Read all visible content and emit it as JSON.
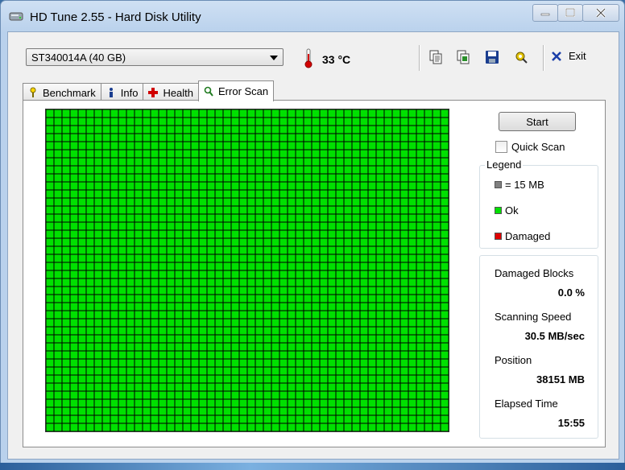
{
  "window": {
    "title": "HD Tune 2.55 - Hard Disk Utility"
  },
  "toolbar": {
    "drive": "ST340014A (40 GB)",
    "temperature": "33 °C",
    "exit_label": "Exit"
  },
  "tabs": [
    {
      "label": "Benchmark"
    },
    {
      "label": "Info"
    },
    {
      "label": "Health"
    },
    {
      "label": "Error Scan"
    }
  ],
  "scan": {
    "start_label": "Start",
    "quick_scan_label": "Quick Scan",
    "quick_scan_checked": false,
    "grid_columns": 50,
    "grid_rows": 40,
    "block_status": "ok"
  },
  "legend": {
    "title": "Legend",
    "block_size": "= 15 MB",
    "ok": "Ok",
    "damaged": "Damaged"
  },
  "stats": {
    "damaged_blocks_label": "Damaged Blocks",
    "damaged_blocks_value": "0.0 %",
    "speed_label": "Scanning Speed",
    "speed_value": "30.5 MB/sec",
    "position_label": "Position",
    "position_value": "38151 MB",
    "elapsed_label": "Elapsed Time",
    "elapsed_value": "15:55"
  },
  "colors": {
    "ok": "#00e000",
    "damaged": "#e00000",
    "block_size": "#808080"
  },
  "icons": [
    "hdd-icon",
    "thermometer-icon",
    "copy-text-icon",
    "copy-image-icon",
    "save-icon",
    "options-icon",
    "exit-icon",
    "benchmark-icon",
    "info-icon",
    "health-icon",
    "error-scan-icon"
  ]
}
